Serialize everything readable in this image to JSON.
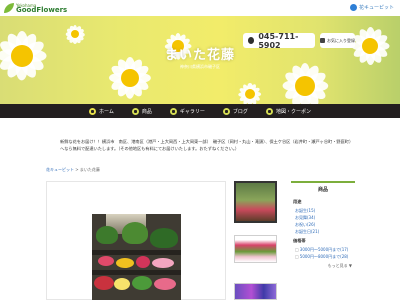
{
  "header": {
    "logo_left_small": "Yokohama",
    "logo_left_main": "GoodFlowers",
    "logo_right": "花キューピット"
  },
  "hero": {
    "shop_name": "まいた花藤",
    "subtitle": "神奈川県横浜市磯子区",
    "phone": "045-711-5902",
    "favorite_label": "お気に入り登録"
  },
  "nav": {
    "items": [
      {
        "label": "ホーム",
        "icon": "home-icon"
      },
      {
        "label": "商品",
        "icon": "gift-icon"
      },
      {
        "label": "ギャラリー",
        "icon": "camera-icon"
      },
      {
        "label": "ブログ",
        "icon": "pencil-icon"
      },
      {
        "label": "地図・クーポン",
        "icon": "map-pin-icon"
      }
    ]
  },
  "intro": {
    "line1": "新鮮な花をお届け！！横浜市　南区、港南区（港戸・上大岡西・上大岡東一部）　磯子区（岡村・丸山・滝頭）、保土ケ谷区（岩井町・瀬戸ヶ谷町・野庭町）",
    "line2": "へなら無料で配達いたします。（その他地区も有料にてお届けいたします。おたずねください。）"
  },
  "breadcrumb": {
    "home": "花キューピット",
    "separator": " > ",
    "current": "まいた花藤"
  },
  "sidebar": {
    "title": "商品",
    "section1_heading": "用途",
    "section1_items": [
      "お誕生(15)",
      "お見舞(34)",
      "お祝い(26)",
      "お誕生日(21)"
    ],
    "section2_heading": "価格帯",
    "section2_items": [
      "3000円～5000円まで(17)",
      "5000円～8000円まで(28)"
    ],
    "more_label": "もっと見る"
  },
  "colors": {
    "nav_bg": "#231f20",
    "accent_green": "#7cae3c",
    "link_blue": "#2e6bb8"
  }
}
